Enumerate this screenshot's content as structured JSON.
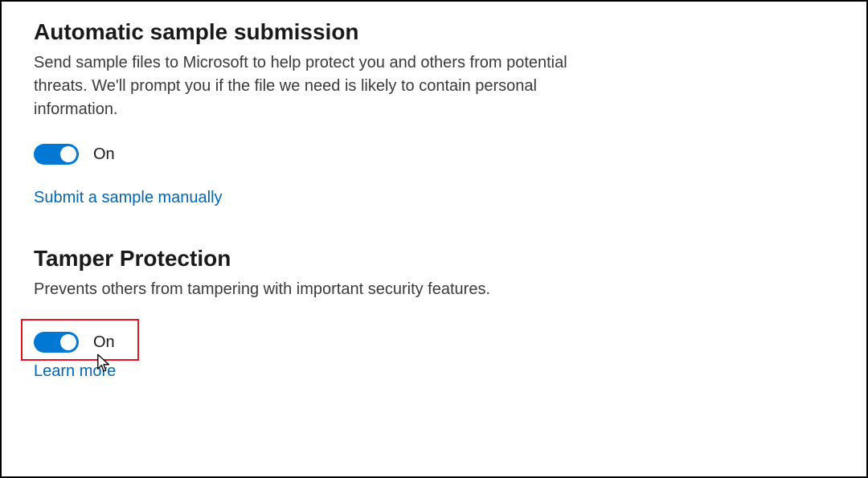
{
  "sections": {
    "automaticSampleSubmission": {
      "title": "Automatic sample submission",
      "description": "Send sample files to Microsoft to help protect you and others from potential threats. We'll prompt you if the file we need is likely to contain personal information.",
      "toggle": {
        "state": "on",
        "label": "On"
      },
      "link": "Submit a sample manually"
    },
    "tamperProtection": {
      "title": "Tamper Protection",
      "description": "Prevents others from tampering with important security features.",
      "toggle": {
        "state": "on",
        "label": "On"
      },
      "link": "Learn more"
    }
  },
  "colors": {
    "accent": "#0078D4",
    "link": "#0066B4",
    "highlight": "#E81123"
  }
}
